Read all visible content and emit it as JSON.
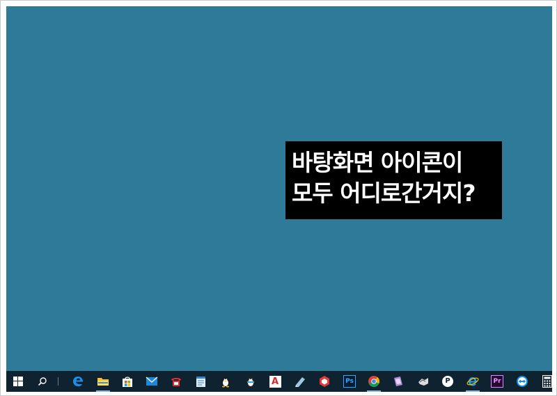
{
  "overlay": {
    "line1": "바탕화면 아이콘이",
    "line2": "모두 어디로간거지?"
  },
  "colors": {
    "desktop_background": "#2e7b99",
    "taskbar_background": "#0f2230",
    "caption_background": "#000000",
    "caption_text": "#ffffff"
  },
  "taskbar": {
    "items": [
      {
        "name": "start-button",
        "icon": "windows-logo-icon"
      },
      {
        "name": "search-button",
        "icon": "search-icon"
      },
      {
        "name": "task-view",
        "icon": "divider"
      },
      {
        "name": "edge",
        "icon": "edge-browser-icon"
      },
      {
        "name": "file-explorer",
        "icon": "folder-icon"
      },
      {
        "name": "store",
        "icon": "store-bag-icon"
      },
      {
        "name": "mail",
        "icon": "mail-icon"
      },
      {
        "name": "app-red-phone",
        "icon": "red-phone-icon"
      },
      {
        "name": "app-notepad",
        "icon": "notepad-icon"
      },
      {
        "name": "app-penguin",
        "icon": "penguin-icon"
      },
      {
        "name": "app-penguin-2",
        "icon": "penguin-icon-2"
      },
      {
        "name": "autocad",
        "icon": "autocad-icon"
      },
      {
        "name": "app-drawing",
        "icon": "drawing-tablet-icon"
      },
      {
        "name": "sketchup",
        "icon": "sketchup-icon"
      },
      {
        "name": "photoshop",
        "icon": "photoshop-icon"
      },
      {
        "name": "chrome",
        "icon": "chrome-icon"
      },
      {
        "name": "app-purple",
        "icon": "purple-app-icon"
      },
      {
        "name": "app-hands",
        "icon": "hands-icon"
      },
      {
        "name": "app-p",
        "icon": "p-circle-icon"
      },
      {
        "name": "internet-explorer",
        "icon": "internet-explorer-icon"
      },
      {
        "name": "premiere",
        "icon": "premiere-icon"
      },
      {
        "name": "teamviewer",
        "icon": "teamviewer-icon"
      },
      {
        "name": "calculator",
        "icon": "calculator-icon"
      }
    ],
    "labels": {
      "autocad": "A",
      "photoshop": "Ps",
      "premiere": "Pr",
      "p_circle": "P"
    }
  }
}
